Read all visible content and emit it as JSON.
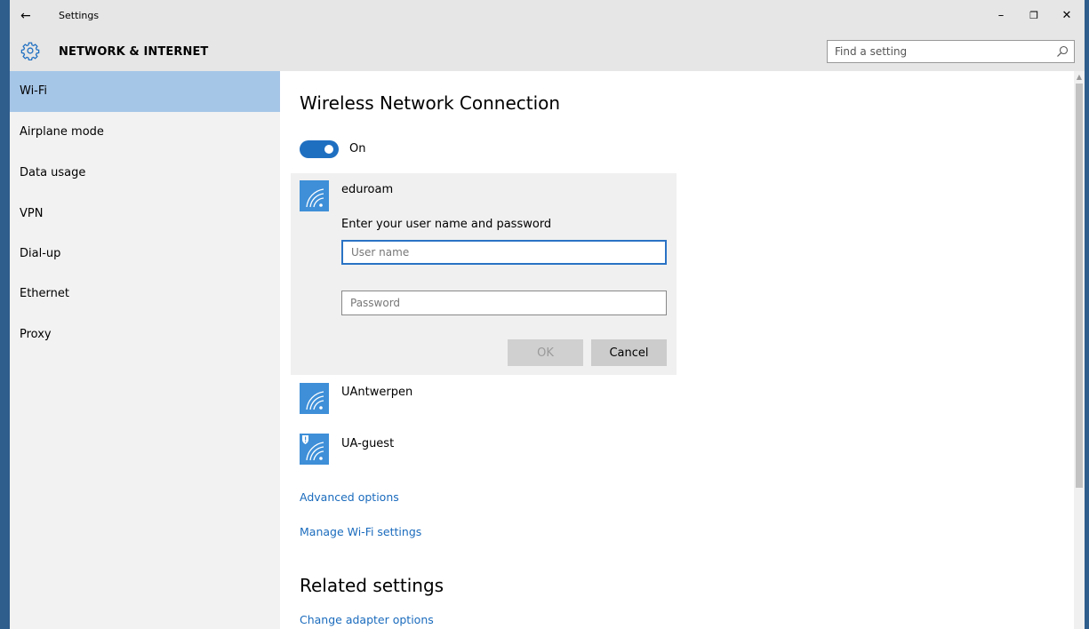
{
  "window": {
    "title": "Settings",
    "back_glyph": "←",
    "controls": {
      "minimize": "–",
      "maximize": "❐",
      "close": "✕"
    }
  },
  "header": {
    "section_title": "NETWORK & INTERNET",
    "search_placeholder": "Find a setting"
  },
  "sidebar": {
    "items": [
      {
        "label": "Wi-Fi",
        "active": true
      },
      {
        "label": "Airplane mode"
      },
      {
        "label": "Data usage"
      },
      {
        "label": "VPN"
      },
      {
        "label": "Dial-up"
      },
      {
        "label": "Ethernet"
      },
      {
        "label": "Proxy"
      }
    ]
  },
  "main": {
    "title": "Wireless Network Connection",
    "toggle_label": "On",
    "networks": [
      {
        "name": "eduroam",
        "prompt": "Enter your user name and password",
        "username_placeholder": "User name",
        "password_placeholder": "Password",
        "ok_label": "OK",
        "cancel_label": "Cancel"
      },
      {
        "name": "UAntwerpen"
      },
      {
        "name": "UA-guest"
      }
    ],
    "links": {
      "advanced": "Advanced options",
      "manage": "Manage Wi-Fi settings"
    },
    "related_title": "Related settings",
    "related_links": {
      "adapter": "Change adapter options"
    }
  },
  "colors": {
    "accent": "#1f6fc1",
    "sidebar_active": "#a6c6e7",
    "wifi_tile": "#3e8fd8",
    "link": "#1a6bbd",
    "desktop": "#2f5d8c"
  }
}
